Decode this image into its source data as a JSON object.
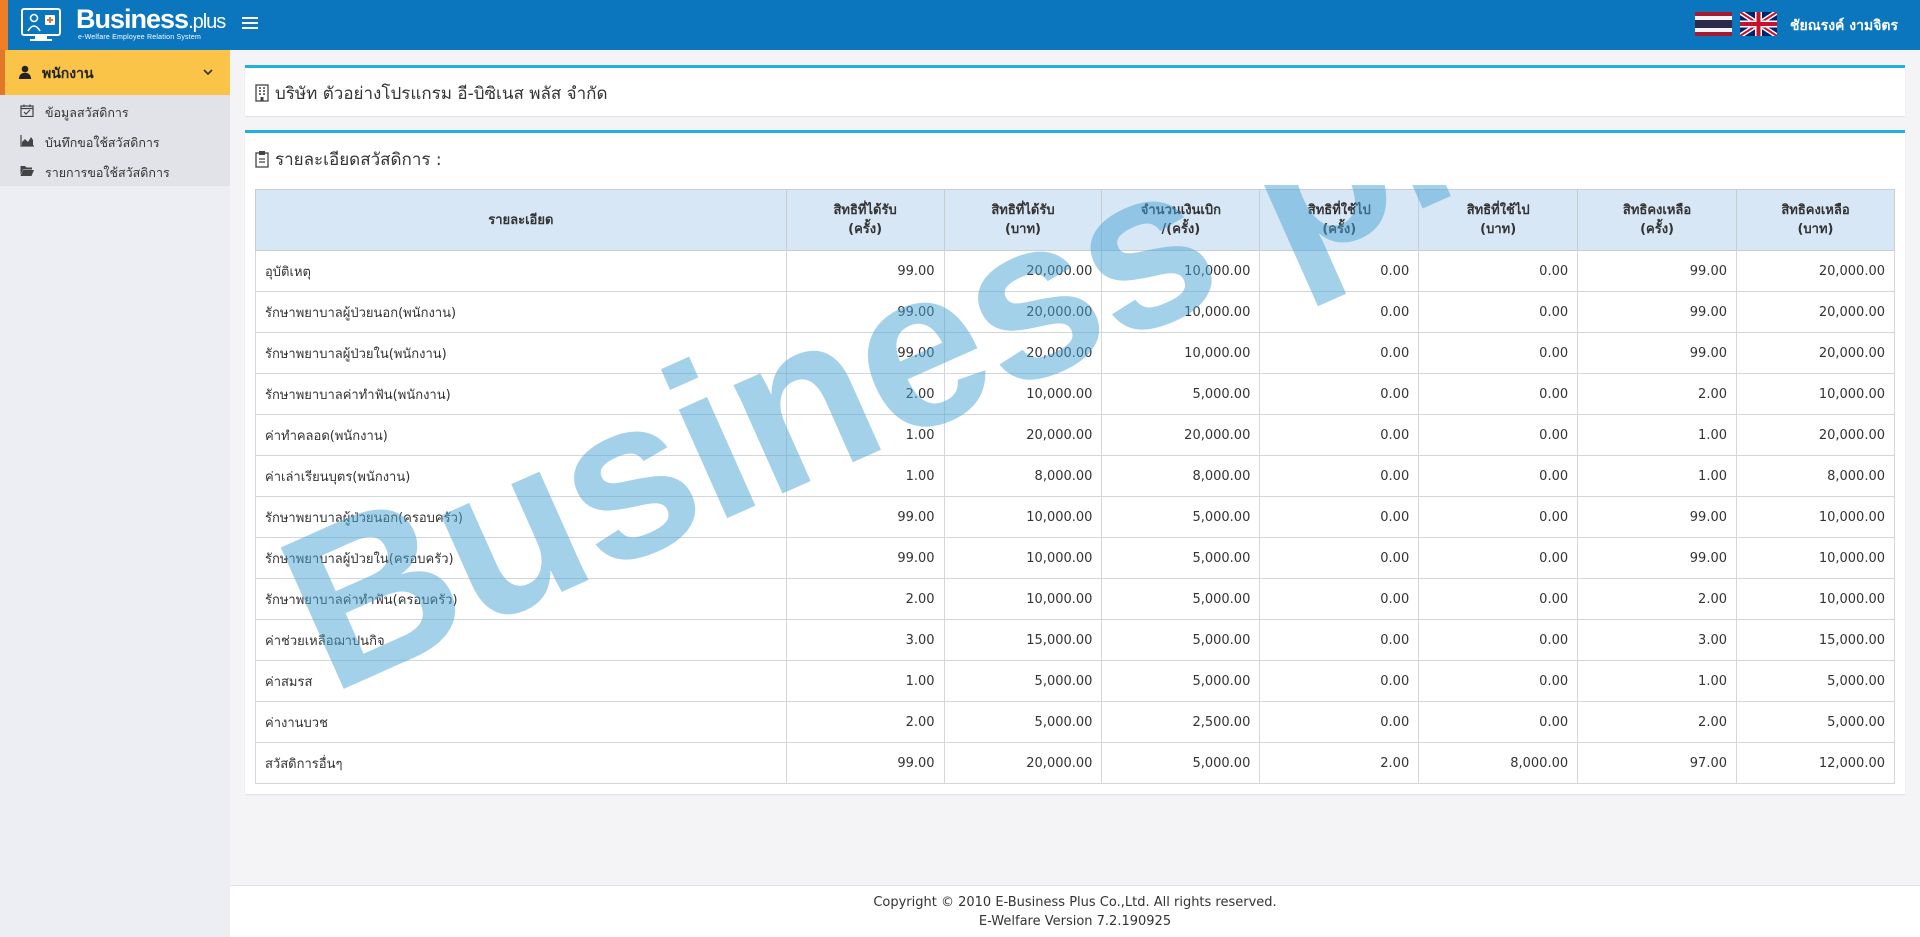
{
  "brand": {
    "title_main": "Business",
    "title_suffix": ".plus",
    "subtitle": "e-Welfare Employee Relation System"
  },
  "header": {
    "username": "ชัยณรงค์ งามจิตร"
  },
  "sidebar": {
    "menu_label": "พนักงาน",
    "items": [
      {
        "label": "ข้อมูลสวัสดิการ",
        "icon": "calendar-check-icon"
      },
      {
        "label": "บันทึกขอใช้สวัสดิการ",
        "icon": "area-chart-icon"
      },
      {
        "label": "รายการขอใช้สวัสดิการ",
        "icon": "folder-open-icon"
      }
    ]
  },
  "company": {
    "name": "บริษัท ตัวอย่างโปรแกรม อี-บิซิเนส พลัส จำกัด"
  },
  "welfare": {
    "section_title": "รายละเอียดสวัสดิการ :",
    "columns": [
      {
        "line1": "รายละเอียด",
        "line2": ""
      },
      {
        "line1": "สิทธิที่ได้รับ",
        "line2": "(ครั้ง)"
      },
      {
        "line1": "สิทธิที่ได้รับ",
        "line2": "(บาท)"
      },
      {
        "line1": "จำนวนเงินเบิก",
        "line2": "/(ครั้ง)"
      },
      {
        "line1": "สิทธิที่ใช้ไป",
        "line2": "(ครั้ง)"
      },
      {
        "line1": "สิทธิที่ใช้ไป",
        "line2": "(บาท)"
      },
      {
        "line1": "สิทธิคงเหลือ",
        "line2": "(ครั้ง)"
      },
      {
        "line1": "สิทธิคงเหลือ",
        "line2": "(บาท)"
      }
    ],
    "rows": [
      [
        "อุบัติเหตุ",
        "99.00",
        "20,000.00",
        "10,000.00",
        "0.00",
        "0.00",
        "99.00",
        "20,000.00"
      ],
      [
        "รักษาพยาบาลผู้ป่วยนอก(พนักงาน)",
        "99.00",
        "20,000.00",
        "10,000.00",
        "0.00",
        "0.00",
        "99.00",
        "20,000.00"
      ],
      [
        "รักษาพยาบาลผู้ป่วยใน(พนักงาน)",
        "99.00",
        "20,000.00",
        "10,000.00",
        "0.00",
        "0.00",
        "99.00",
        "20,000.00"
      ],
      [
        "รักษาพยาบาลค่าทำฟัน(พนักงาน)",
        "2.00",
        "10,000.00",
        "5,000.00",
        "0.00",
        "0.00",
        "2.00",
        "10,000.00"
      ],
      [
        "ค่าทำคลอด(พนักงาน)",
        "1.00",
        "20,000.00",
        "20,000.00",
        "0.00",
        "0.00",
        "1.00",
        "20,000.00"
      ],
      [
        "ค่าเล่าเรียนบุตร(พนักงาน)",
        "1.00",
        "8,000.00",
        "8,000.00",
        "0.00",
        "0.00",
        "1.00",
        "8,000.00"
      ],
      [
        "รักษาพยาบาลผู้ป่วยนอก(ครอบครัว)",
        "99.00",
        "10,000.00",
        "5,000.00",
        "0.00",
        "0.00",
        "99.00",
        "10,000.00"
      ],
      [
        "รักษาพยาบาลผู้ป่วยใน(ครอบครัว)",
        "99.00",
        "10,000.00",
        "5,000.00",
        "0.00",
        "0.00",
        "99.00",
        "10,000.00"
      ],
      [
        "รักษาพยาบาลค่าทำฟัน(ครอบครัว)",
        "2.00",
        "10,000.00",
        "5,000.00",
        "0.00",
        "0.00",
        "2.00",
        "10,000.00"
      ],
      [
        "ค่าช่วยเหลือฌาปนกิจ",
        "3.00",
        "15,000.00",
        "5,000.00",
        "0.00",
        "0.00",
        "3.00",
        "15,000.00"
      ],
      [
        "ค่าสมรส",
        "1.00",
        "5,000.00",
        "5,000.00",
        "0.00",
        "0.00",
        "1.00",
        "5,000.00"
      ],
      [
        "ค่างานบวช",
        "2.00",
        "5,000.00",
        "2,500.00",
        "0.00",
        "0.00",
        "2.00",
        "5,000.00"
      ],
      [
        "สวัสดิการอื่นๆ",
        "99.00",
        "20,000.00",
        "5,000.00",
        "2.00",
        "8,000.00",
        "97.00",
        "12,000.00"
      ]
    ]
  },
  "watermark": "Business plus",
  "footer": {
    "copyright": "Copyright © 2010 E-Business Plus Co.,Ltd. All rights reserved.",
    "version": "E-Welfare Version 7.2.190925"
  },
  "colors": {
    "topbar": "#0b76be",
    "menu_active": "#f9c448",
    "panel_accent": "#21b1dd",
    "table_header": "#d8e7f5",
    "watermark": "#4aa3d5"
  }
}
